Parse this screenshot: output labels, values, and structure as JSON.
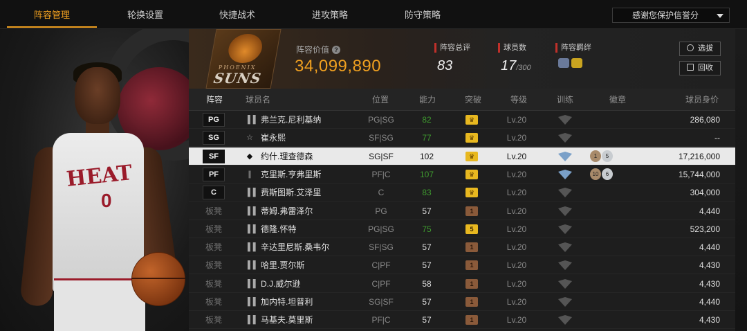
{
  "nav": {
    "tabs": [
      "阵容管理",
      "轮换设置",
      "快捷战术",
      "进攻策略",
      "防守策略"
    ],
    "dropdown_label": "感谢您保护信誉分"
  },
  "player_art": {
    "jersey_text": "HEAT",
    "jersey_number": "0"
  },
  "team": {
    "logo_top": "PHOENIX",
    "logo_name": "SUNS",
    "value_label": "阵容价值",
    "value": "34,099,890",
    "rating_label": "阵容总评",
    "rating": "83",
    "players_label": "球员数",
    "players_count": "17",
    "players_max": "/300",
    "bond_label": "阵容羁绊",
    "select_button": "选拔",
    "recycle_button": "回收"
  },
  "table": {
    "headers": [
      "阵容",
      "球员名",
      "位置",
      "能力",
      "突破",
      "等级",
      "训练",
      "徽章",
      "球员身价"
    ],
    "rows": [
      {
        "slot": "PG",
        "name": "弗兰克.尼利基纳",
        "pos": "PG|SG",
        "ability": "82",
        "ability_color": "green",
        "breakthrough": "gold",
        "level": "Lv.20",
        "price": "286,080",
        "selected": false,
        "icon": "bars"
      },
      {
        "slot": "SG",
        "name": "崔永熙",
        "pos": "SF|SG",
        "ability": "77",
        "ability_color": "green",
        "breakthrough": "gold",
        "level": "Lv.20",
        "price": "--",
        "selected": false,
        "icon": "star"
      },
      {
        "slot": "SF",
        "name": "约什.理查德森",
        "pos": "SG|SF",
        "ability": "102",
        "ability_color": "normal",
        "breakthrough": "gold",
        "level": "Lv.20",
        "price": "17,216,000",
        "selected": true,
        "icon": "diamond",
        "badges": [
          "1",
          "5"
        ],
        "trained": true
      },
      {
        "slot": "PF",
        "name": "克里斯.亨弗里斯",
        "pos": "PF|C",
        "ability": "107",
        "ability_color": "green",
        "breakthrough": "gold",
        "level": "Lv.20",
        "price": "15,744,000",
        "selected": false,
        "icon": "bars2",
        "badges": [
          "10",
          "6"
        ],
        "trained": true
      },
      {
        "slot": "C",
        "name": "费斯图斯.艾泽里",
        "pos": "C",
        "ability": "83",
        "ability_color": "green",
        "breakthrough": "gold",
        "level": "Lv.20",
        "price": "304,000",
        "selected": false,
        "icon": "bars"
      },
      {
        "slot": "板凳",
        "name": "蒂姆.弗雷泽尔",
        "pos": "PG",
        "ability": "57",
        "ability_color": "normal",
        "breakthrough": "1",
        "level": "Lv.20",
        "price": "4,440",
        "selected": false,
        "icon": "bars"
      },
      {
        "slot": "板凳",
        "name": "德隆.怀特",
        "pos": "PG|SG",
        "ability": "75",
        "ability_color": "green",
        "breakthrough": "5",
        "level": "Lv.20",
        "price": "523,200",
        "selected": false,
        "icon": "bars"
      },
      {
        "slot": "板凳",
        "name": "辛达里尼斯.桑韦尔",
        "pos": "SF|SG",
        "ability": "57",
        "ability_color": "normal",
        "breakthrough": "1",
        "level": "Lv.20",
        "price": "4,440",
        "selected": false,
        "icon": "bars"
      },
      {
        "slot": "板凳",
        "name": "哈里.贾尔斯",
        "pos": "C|PF",
        "ability": "57",
        "ability_color": "normal",
        "breakthrough": "1",
        "level": "Lv.20",
        "price": "4,430",
        "selected": false,
        "icon": "bars"
      },
      {
        "slot": "板凳",
        "name": "D.J.威尔逊",
        "pos": "C|PF",
        "ability": "58",
        "ability_color": "normal",
        "breakthrough": "1",
        "level": "Lv.20",
        "price": "4,430",
        "selected": false,
        "icon": "bars"
      },
      {
        "slot": "板凳",
        "name": "加内特.坦普利",
        "pos": "SG|SF",
        "ability": "57",
        "ability_color": "normal",
        "breakthrough": "1",
        "level": "Lv.20",
        "price": "4,440",
        "selected": false,
        "icon": "bars"
      },
      {
        "slot": "板凳",
        "name": "马基夫.莫里斯",
        "pos": "PF|C",
        "ability": "57",
        "ability_color": "normal",
        "breakthrough": "1",
        "level": "Lv.20",
        "price": "4,430",
        "selected": false,
        "icon": "bars"
      }
    ]
  },
  "colors": {
    "accent": "#f0a020",
    "green": "#3f9a2f",
    "red_marker": "#c0302a",
    "gold_badge": "#e8b820",
    "bronze_badge": "#8a5a3a"
  }
}
